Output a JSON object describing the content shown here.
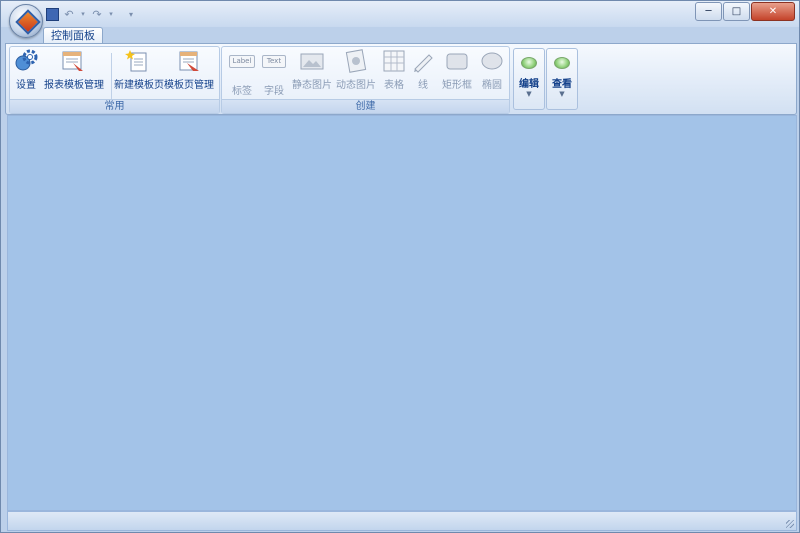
{
  "quick_access": {
    "save": "save-icon",
    "undo": "undo-icon",
    "redo": "redo-icon",
    "customize": "dropdown-icon"
  },
  "window_controls": {
    "minimize": "─",
    "maximize": "□",
    "close": "✕"
  },
  "tabs": [
    {
      "label": "控制面板",
      "active": true
    }
  ],
  "groups": {
    "common": {
      "label": "常用",
      "buttons": [
        {
          "label": "设置",
          "icon": "settings-gear-icon"
        },
        {
          "label": "报表模板管理",
          "icon": "report-template-icon"
        },
        {
          "label": "新建模板页",
          "icon": "new-template-page-icon"
        },
        {
          "label": "模板页管理",
          "icon": "template-page-manage-icon"
        }
      ]
    },
    "create": {
      "label": "创建",
      "buttons": [
        {
          "label": "标签",
          "icon_text": "Label",
          "enabled": false
        },
        {
          "label": "字段",
          "icon_text": "Text",
          "enabled": false
        },
        {
          "label": "静态图片",
          "icon": "static-image-icon",
          "enabled": false
        },
        {
          "label": "动态图片",
          "icon": "dynamic-image-icon",
          "enabled": false
        },
        {
          "label": "表格",
          "icon": "table-icon",
          "enabled": false
        },
        {
          "label": "线",
          "icon": "line-icon",
          "enabled": false
        },
        {
          "label": "矩形框",
          "icon": "rectangle-icon",
          "enabled": false
        },
        {
          "label": "椭圆",
          "icon": "ellipse-icon",
          "enabled": false
        }
      ]
    },
    "edit": {
      "label": "编辑"
    },
    "view": {
      "label": "查看"
    }
  },
  "colors": {
    "accent": "#15428b",
    "client_bg": "#a3c3e8",
    "ribbon_bg": "#dde8f6"
  }
}
